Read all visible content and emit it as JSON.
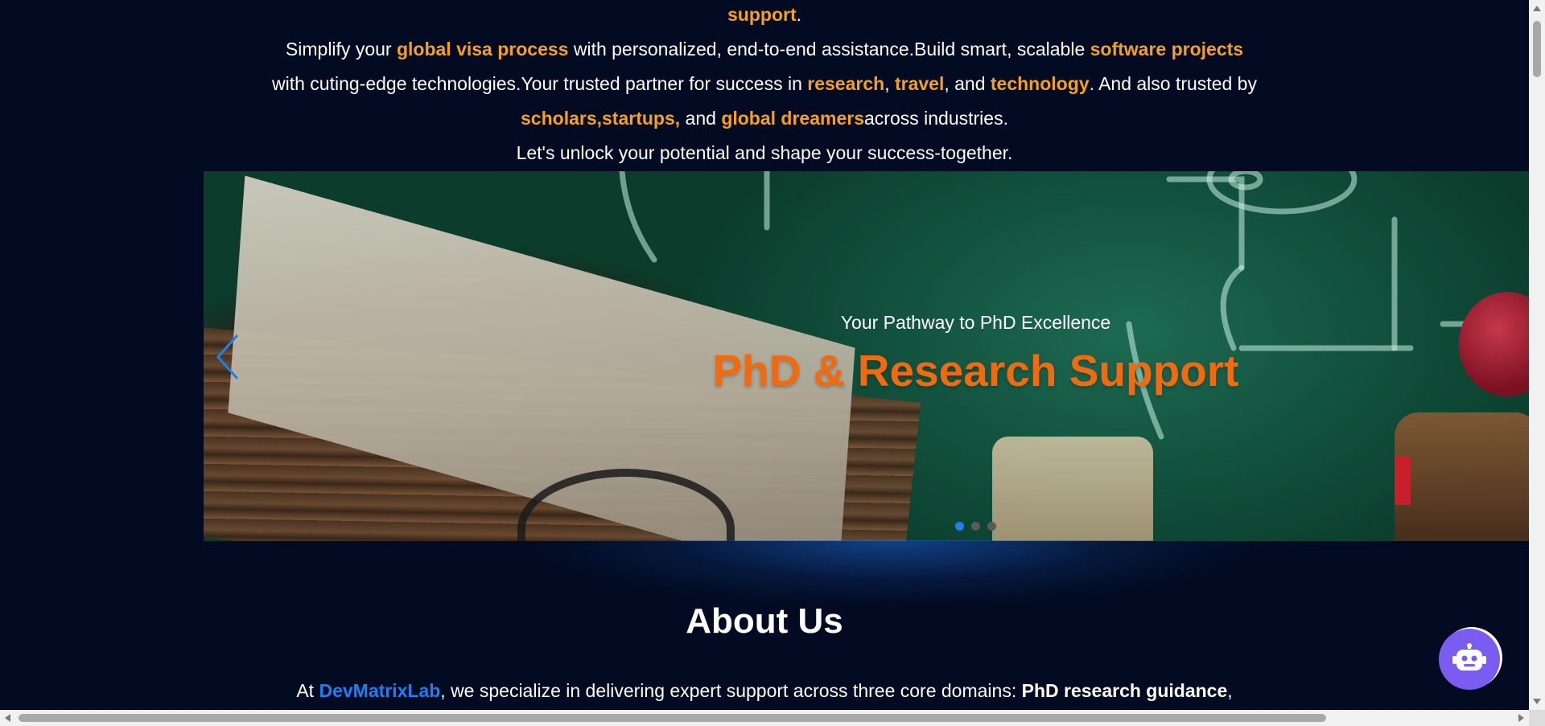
{
  "intro": {
    "line1": {
      "hl": "support",
      "tail": "."
    },
    "line2": {
      "t1": "Simplify your ",
      "hl1": "global visa process",
      "t2": " with personalized, end-to-end assistance.Build smart, scalable ",
      "hl2": "software projects"
    },
    "line3": {
      "t1": "with cuting-edge technologies.Your trusted partner for success in ",
      "hl1": "research",
      "t2": ", ",
      "hl2": "travel",
      "t3": ", and ",
      "hl3": "technology",
      "t4": ". And also trusted by"
    },
    "line4": {
      "hl1": "scholars,startups,",
      "t1": " and ",
      "hl2": "global dreamers",
      "t2": "across industries."
    },
    "line5": "Let's unlock your potential and shape your success-together."
  },
  "hero": {
    "subtitle": "Your Pathway to PhD Excellence",
    "title": "PhD & Research Support",
    "slides_count": 3,
    "active_slide": 1
  },
  "about": {
    "title": "About Us",
    "text": {
      "t1": "At ",
      "brand": "DevMatrixLab",
      "t2": ", we specialize in delivering expert support across three core domains: ",
      "bold1": "PhD research guidance",
      "t3": ","
    }
  },
  "icons": {
    "prev": "chevron-left-icon",
    "chatbot": "robot-icon"
  },
  "colors": {
    "background": "#020b22",
    "highlight": "#f5a01e",
    "hero_title": "#f26a0f",
    "brand": "#1f7ff0",
    "chatbot": "#7b5cf0"
  }
}
